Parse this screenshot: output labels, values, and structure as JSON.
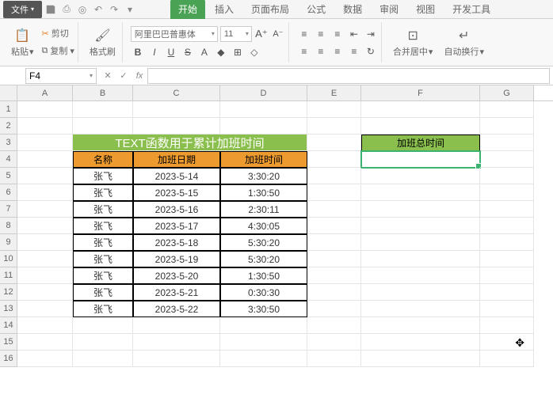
{
  "menu": {
    "file": "文件"
  },
  "tabs": {
    "start": "开始",
    "insert": "插入",
    "layout": "页面布局",
    "formula": "公式",
    "data": "数据",
    "review": "审阅",
    "view": "视图",
    "dev": "开发工具"
  },
  "ribbon": {
    "paste": "粘贴",
    "cut": "剪切",
    "copy": "复制",
    "format_painter": "格式刷",
    "font_name": "阿里巴巴普惠体",
    "font_size": "11",
    "merge_center": "合并居中",
    "wrap_text": "自动换行"
  },
  "namebox": "F4",
  "columns": [
    "A",
    "B",
    "C",
    "D",
    "E",
    "F",
    "G"
  ],
  "rows": [
    "1",
    "2",
    "3",
    "4",
    "5",
    "6",
    "7",
    "8",
    "9",
    "10",
    "11",
    "12",
    "13",
    "14",
    "15",
    "16"
  ],
  "table": {
    "title": "TEXT函数用于累计加班时间",
    "headers": {
      "name": "名称",
      "date": "加班日期",
      "time": "加班时间"
    },
    "data": [
      {
        "name": "张飞",
        "date": "2023-5-14",
        "time": "3:30:20"
      },
      {
        "name": "张飞",
        "date": "2023-5-15",
        "time": "1:30:50"
      },
      {
        "name": "张飞",
        "date": "2023-5-16",
        "time": "2:30:11"
      },
      {
        "name": "张飞",
        "date": "2023-5-17",
        "time": "4:30:05"
      },
      {
        "name": "张飞",
        "date": "2023-5-18",
        "time": "5:30:20"
      },
      {
        "name": "张飞",
        "date": "2023-5-19",
        "time": "5:30:20"
      },
      {
        "name": "张飞",
        "date": "2023-5-20",
        "time": "1:30:50"
      },
      {
        "name": "张飞",
        "date": "2023-5-21",
        "time": "0:30:30"
      },
      {
        "name": "张飞",
        "date": "2023-5-22",
        "time": "3:30:50"
      }
    ],
    "sum_header": "加班总时间"
  }
}
